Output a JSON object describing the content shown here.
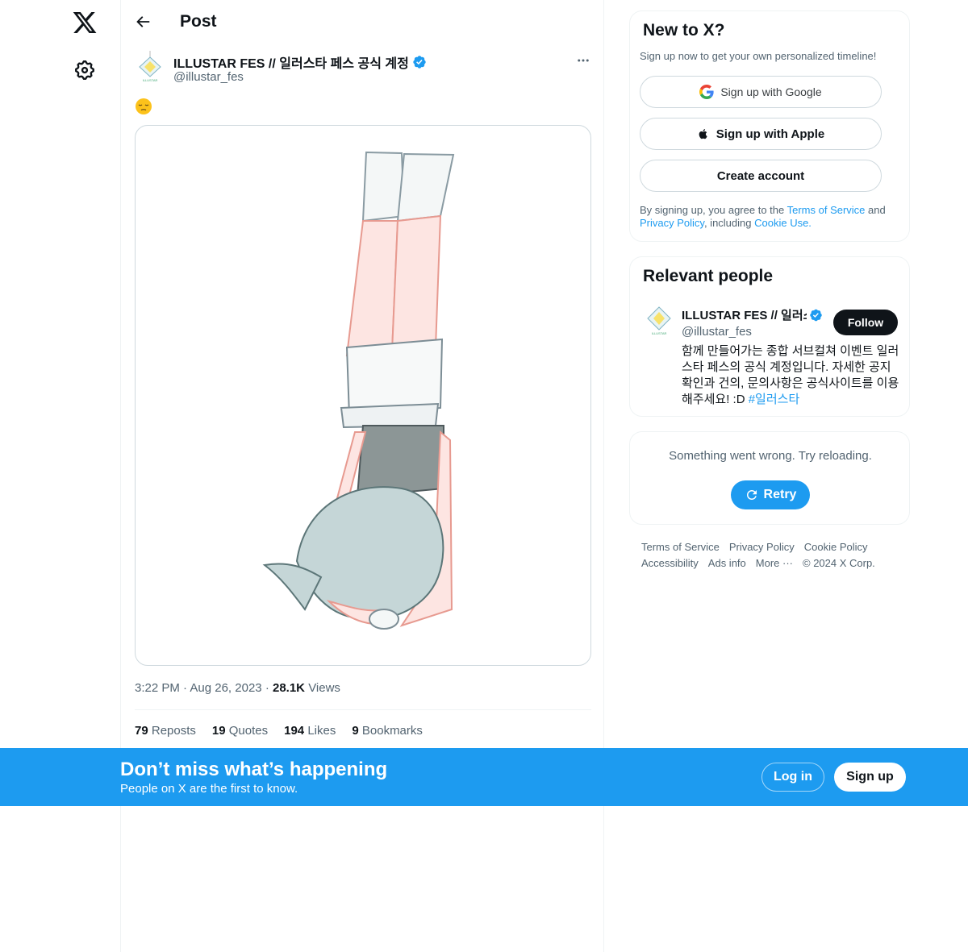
{
  "nav": {
    "logo_icon": "x-logo-icon",
    "settings_icon": "gear-icon"
  },
  "header": {
    "title": "Post",
    "back_icon": "back-arrow-icon"
  },
  "post": {
    "author_name": "ILLUSTAR FES // 일러스타 페스 공식 계정",
    "author_handle": "@illustar_fes",
    "text_emoji": "😔",
    "time": "3:22 PM",
    "date": "Aug 26, 2023",
    "views_count": "28.1K",
    "views_label": "Views",
    "sep": "·",
    "stats": [
      {
        "count": "79",
        "label": "Reposts"
      },
      {
        "count": "19",
        "label": "Quotes"
      },
      {
        "count": "194",
        "label": "Likes"
      },
      {
        "count": "9",
        "label": "Bookmarks"
      }
    ]
  },
  "signup_card": {
    "title": "New to X?",
    "subtitle": "Sign up now to get your own personalized timeline!",
    "google_label": "Sign up with Google",
    "apple_label": "Sign up with Apple",
    "create_label": "Create account",
    "terms_prefix": "By signing up, you agree to the ",
    "terms_link": "Terms of Service",
    "terms_and": " and",
    "privacy_link": "Privacy Policy",
    "terms_including": ", including ",
    "cookie_link": "Cookie Use."
  },
  "relevant": {
    "title": "Relevant people",
    "name": "ILLUSTAR FES // 일러스타 페스 공식 계정",
    "handle": "@illustar_fes",
    "follow_label": "Follow",
    "bio": "함께 만들어가는 종합 서브컬쳐 이벤트 일러스타 페스의 공식 계정입니다. 자세한 공지 확인과 건의, 문의사항은 공식사이트를 이용해주세요! :D ",
    "bio_tag": "#일러스타"
  },
  "error_card": {
    "message": "Something went wrong. Try reloading.",
    "retry_label": "Retry"
  },
  "footer": {
    "links": [
      "Terms of Service",
      "Privacy Policy",
      "Cookie Policy",
      "Accessibility",
      "Ads info",
      "More ···",
      "© 2024 X Corp."
    ]
  },
  "banner": {
    "title": "Don’t miss what’s happening",
    "subtitle": "People on X are the first to know.",
    "login_label": "Log in",
    "signup_label": "Sign up"
  },
  "colors": {
    "accent": "#1d9bf0",
    "text": "#0f1419",
    "muted": "#536471",
    "border": "#eff3f4"
  }
}
